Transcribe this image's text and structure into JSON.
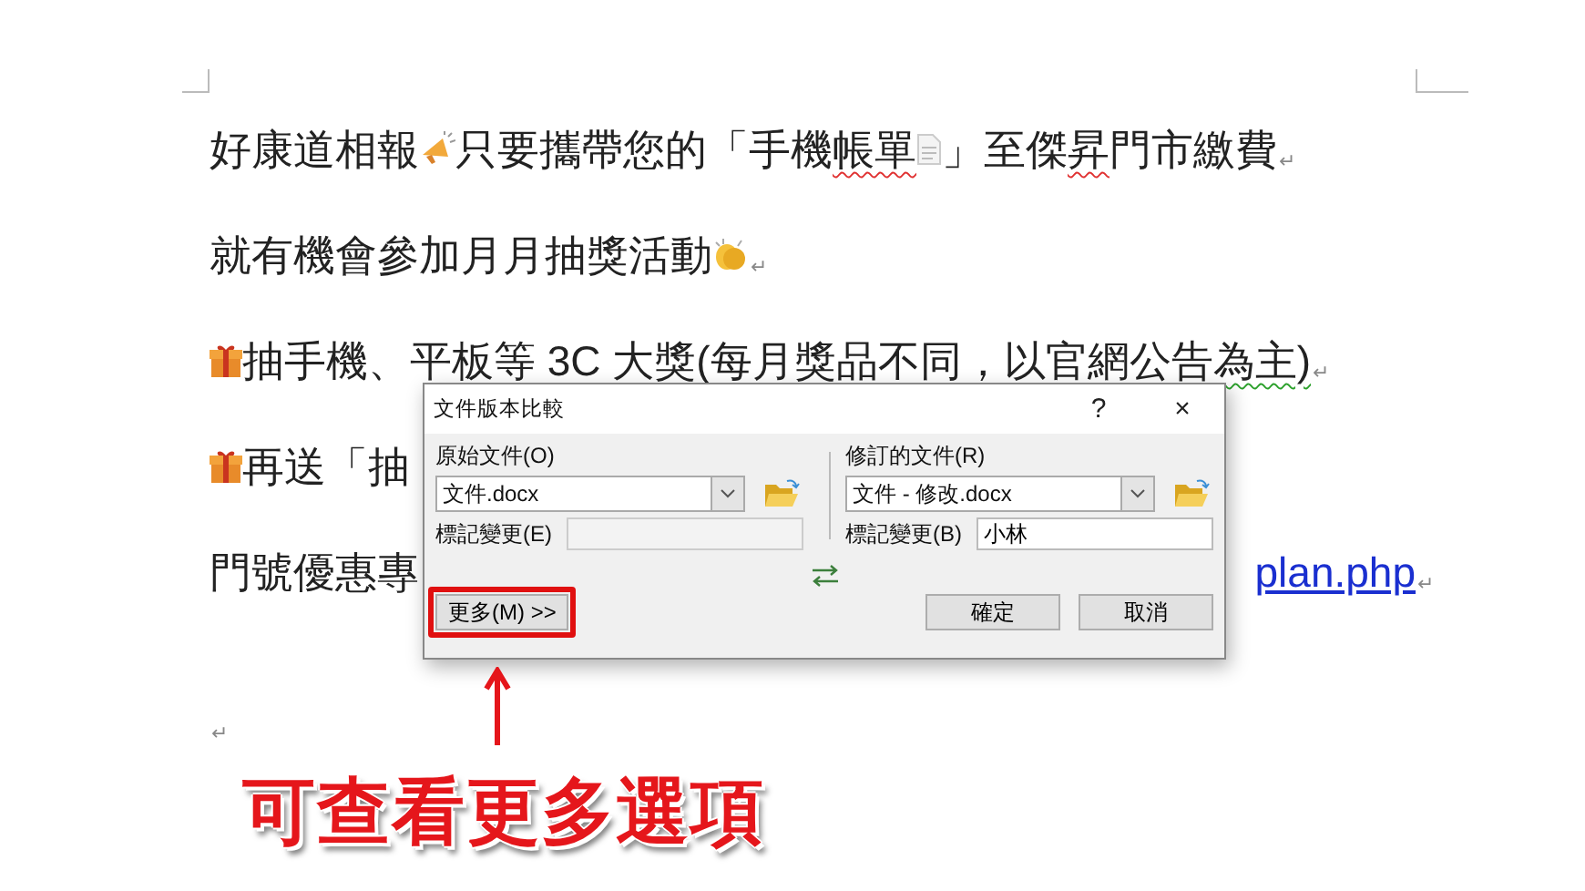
{
  "document": {
    "paragraphs": [
      {
        "segments": [
          {
            "kind": "text",
            "text": "好康道相報"
          },
          {
            "kind": "megaphone"
          },
          {
            "kind": "text",
            "text": " 只要攜帶您的「手機"
          },
          {
            "kind": "text",
            "text": "帳單",
            "spelling_error": true
          },
          {
            "kind": "paper"
          },
          {
            "kind": "text",
            "text": "」至傑"
          },
          {
            "kind": "text",
            "text": "昇",
            "spelling_error": true
          },
          {
            "kind": "text",
            "text": "門市繳費"
          }
        ],
        "end_mark": "↵"
      },
      {
        "segments": [
          {
            "kind": "text",
            "text": "就有機會參加月月抽獎活動"
          },
          {
            "kind": "clap"
          }
        ],
        "end_mark": "↵"
      },
      {
        "segments": [
          {
            "kind": "gift"
          },
          {
            "kind": "text",
            "text": "抽手機、平板等 3C 大獎(每月獎品不同，以官網公告"
          },
          {
            "kind": "text",
            "text": "為主)",
            "grammar_error": true
          }
        ],
        "end_mark": "↵"
      },
      {
        "segments": [
          {
            "kind": "gift"
          },
          {
            "kind": "text",
            "text": "再送「抽"
          }
        ]
      },
      {
        "segments": [
          {
            "kind": "text",
            "text": "門號優惠專"
          },
          {
            "kind": "link",
            "text": "plan.php"
          }
        ],
        "end_mark": "↵"
      },
      {
        "end_mark": "↵"
      }
    ]
  },
  "dialog": {
    "title": "文件版本比較",
    "help": "?",
    "close": "×",
    "original": {
      "label": "原始文件(O)",
      "file": "文件.docx",
      "mark_label": "標記變更(E)",
      "mark_disabled": true
    },
    "revised": {
      "label": "修訂的文件(R)",
      "file": "文件 - 修改.docx",
      "mark_label": "標記變更(B)",
      "mark_value": "小林",
      "mark_disabled": false
    },
    "buttons": [
      {
        "label": "更多(M) >>",
        "highlighted": true
      },
      {
        "label": "確定"
      },
      {
        "label": "取消"
      }
    ]
  },
  "annotation": {
    "caption": "可查看更多選項"
  }
}
